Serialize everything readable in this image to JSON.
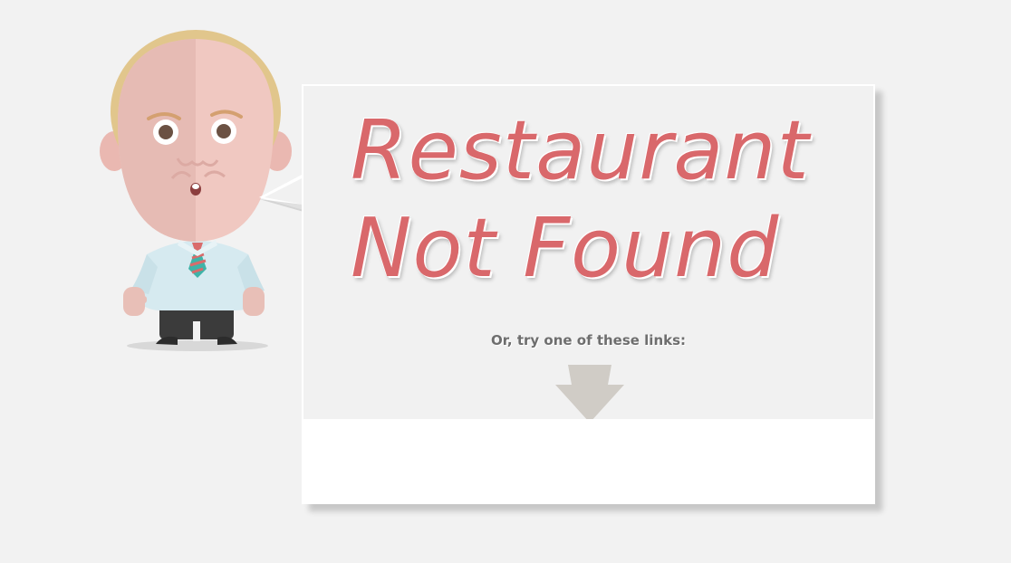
{
  "headline": {
    "line1": "Restaurant",
    "line2": "Not Found"
  },
  "subtext": "Or, try one of these links:",
  "icons": {
    "mascot": "confused-waiter-mascot",
    "arrow": "down-arrow-icon"
  },
  "colors": {
    "background": "#f2f2f2",
    "card": "#f1f1f1",
    "headline": "#d9686b",
    "subtext": "#6e6e6e",
    "arrow": "#d0ccc6"
  }
}
